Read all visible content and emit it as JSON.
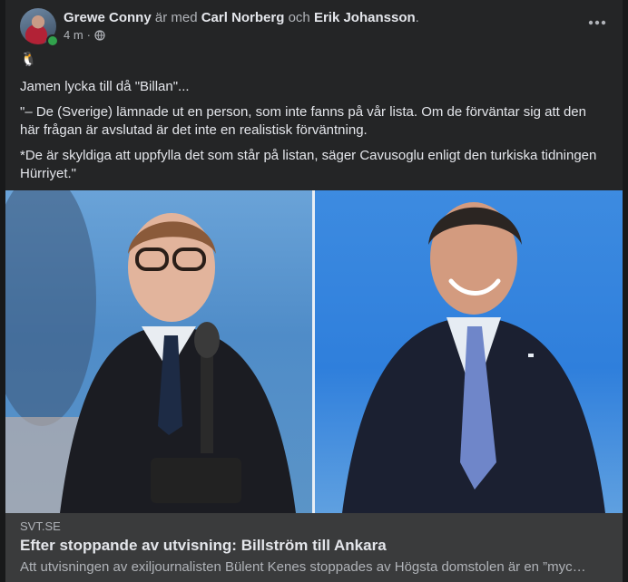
{
  "post": {
    "author": "Grewe Conny",
    "with_text": "är med",
    "tagged_1": "Carl Norberg",
    "and_text": "och",
    "tagged_2": "Erik Johansson",
    "period": ".",
    "time": "4 m",
    "separator": "·",
    "audience_icon": "globe-icon",
    "more_icon": "more-options-icon",
    "emoji": "🐧",
    "paragraphs": [
      "Jamen lycka till då \"Billan\"...",
      "\"– De (Sverige) lämnade ut en person, som inte fanns på vår lista. Om de förväntar sig att den här frågan är avslutad är det inte en realistisk förväntning.",
      "*De är skyldiga att uppfylla det som står på listan, säger Cavusoglu enligt den turkiska tidningen Hürriyet.\""
    ]
  },
  "link": {
    "domain": "SVT.SE",
    "title": "Efter stoppande av utvisning: Billström till Ankara",
    "description": "Att utvisningen av exiljournalisten Bülent Kenes stoppades av Högsta domstolen är en ”myck…"
  },
  "colors": {
    "card_bg": "#242526",
    "link_bg": "#3a3b3c",
    "online": "#31a24c"
  }
}
